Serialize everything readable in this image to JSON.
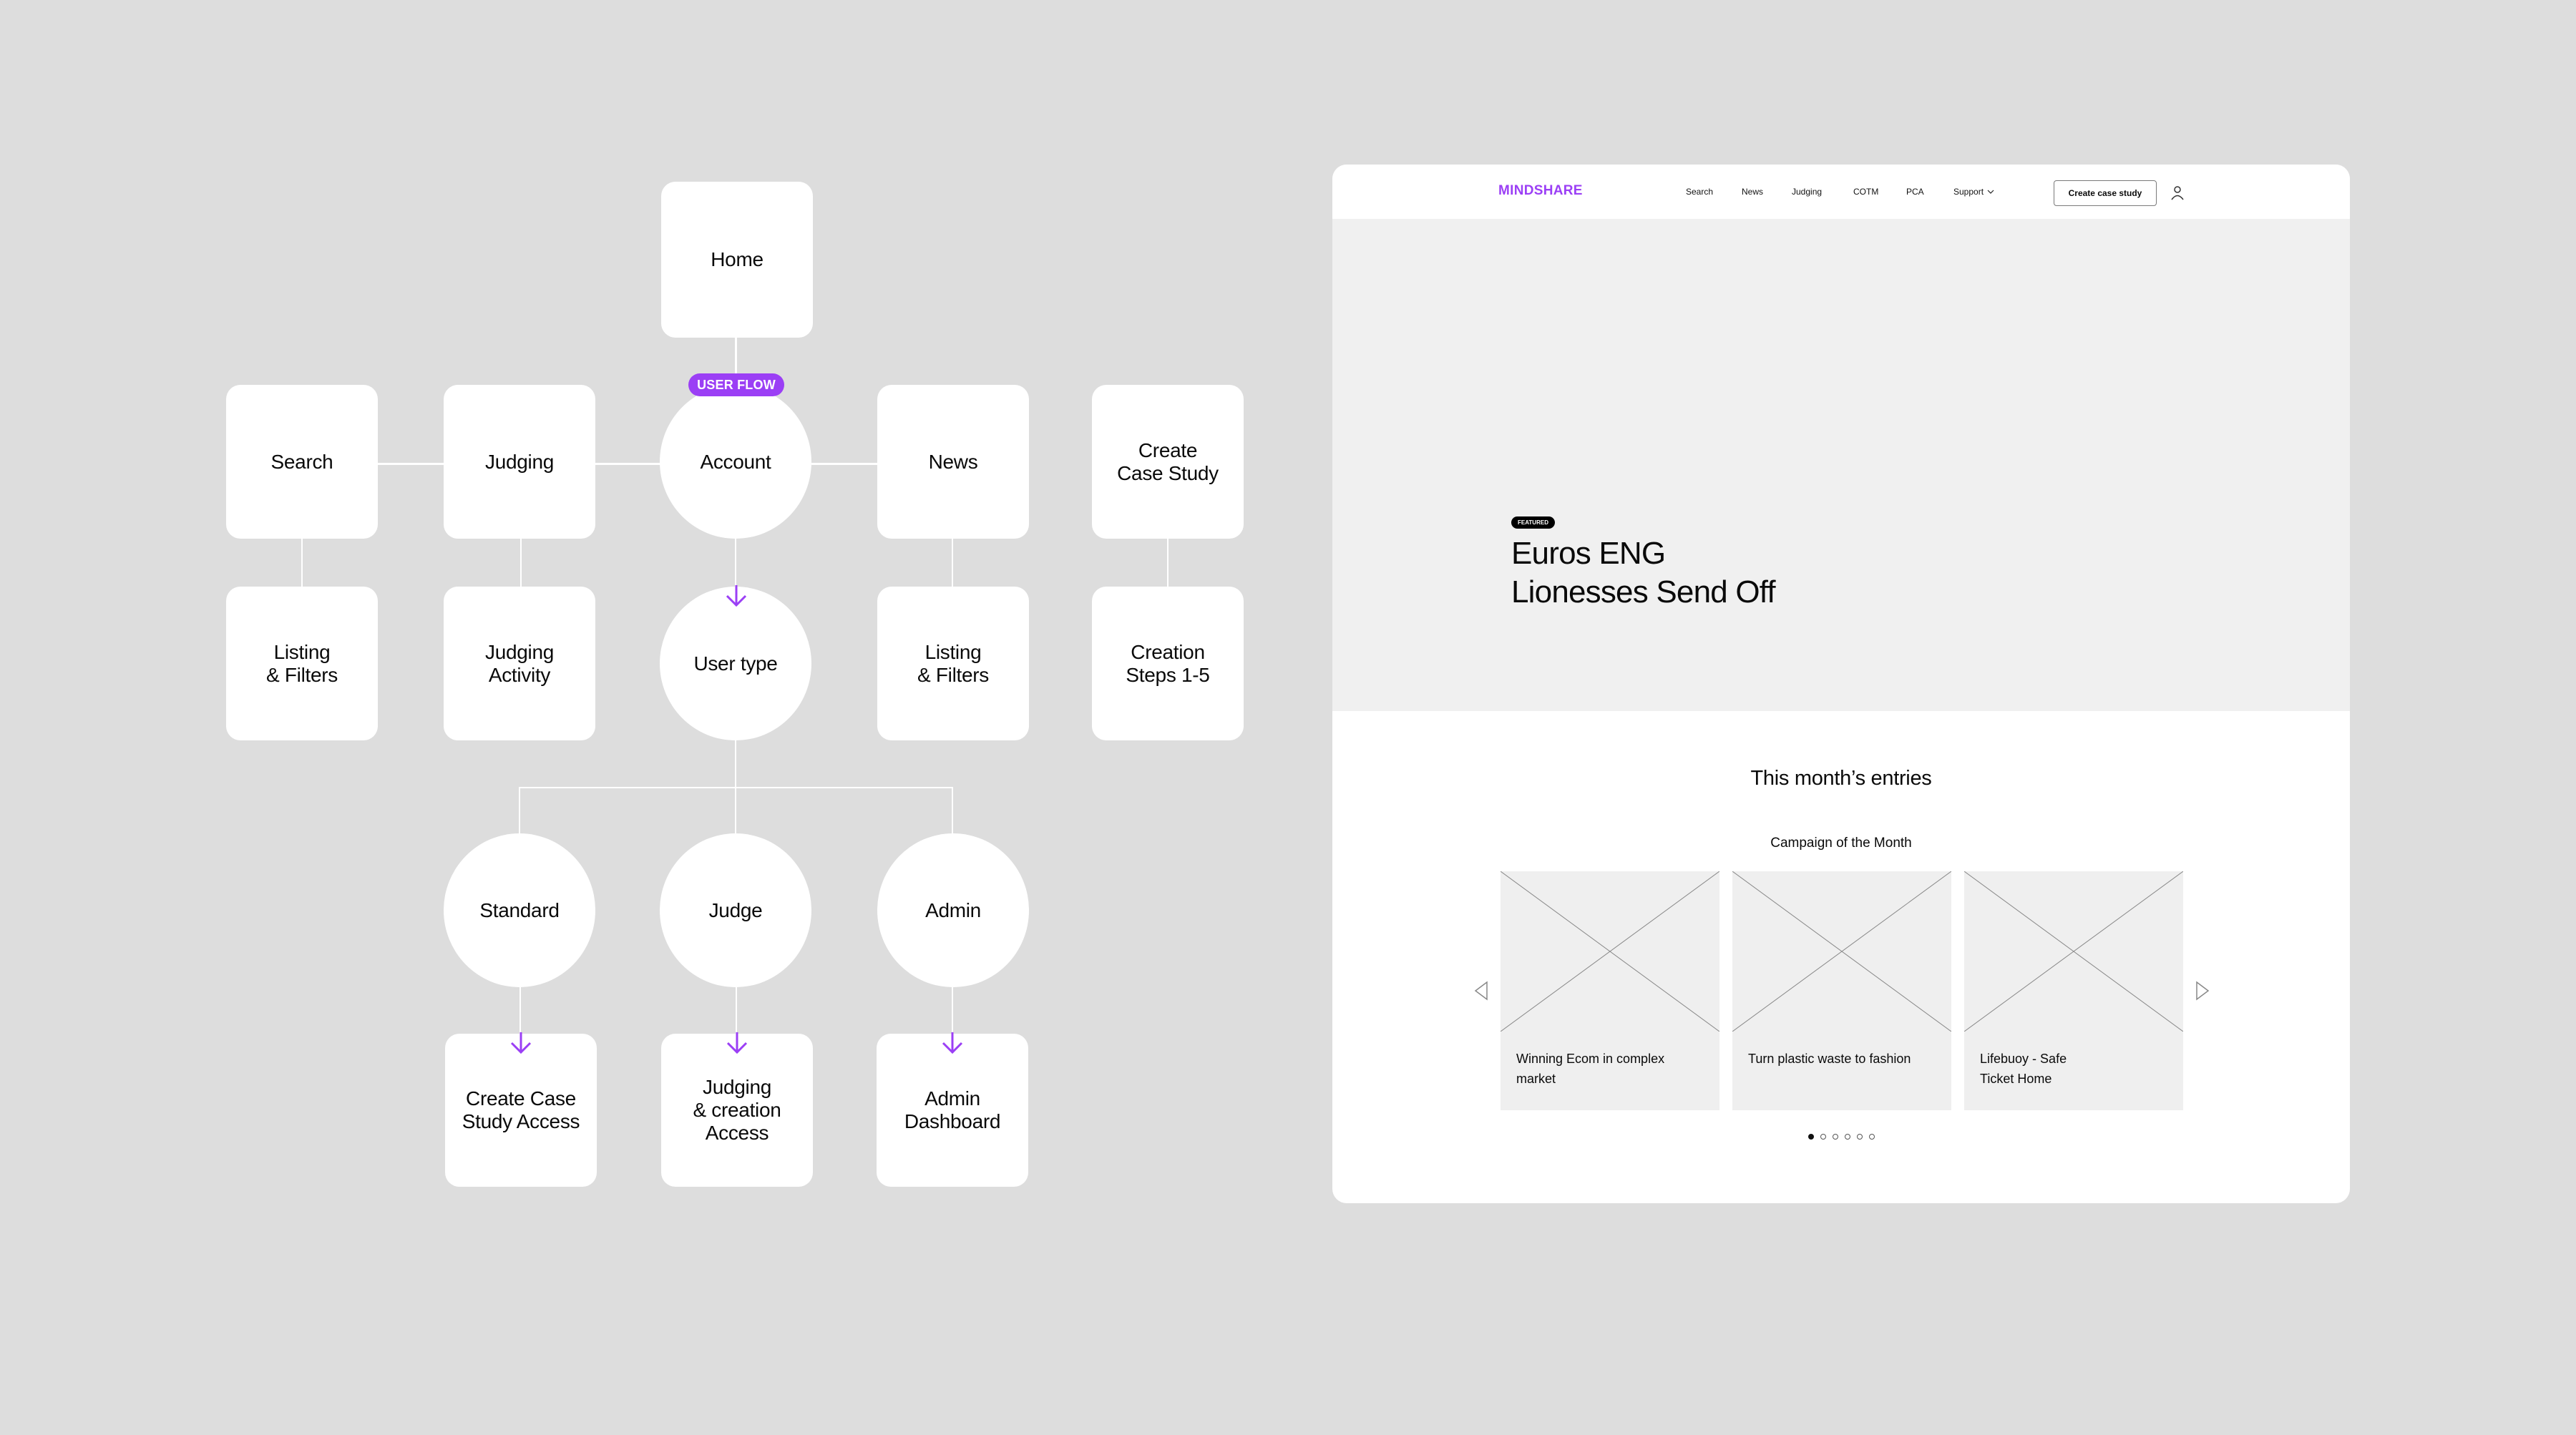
{
  "diagram": {
    "badge": "USER FLOW",
    "nodes": {
      "home": "Home",
      "search": "Search",
      "judging": "Judging",
      "account": "Account",
      "news": "News",
      "create_case_study": "Create\nCase Study",
      "search_listing": "Listing\n& Filters",
      "judging_activity": "Judging\nActivity",
      "user_type": "User type",
      "news_listing": "Listing\n& Filters",
      "creation_steps": "Creation\nSteps 1-5",
      "standard": "Standard",
      "judge": "Judge",
      "admin": "Admin",
      "create_access": "Create Case\nStudy Access",
      "judging_access": "Judging\n& creation\nAccess",
      "admin_dashboard": "Admin\nDashboard"
    },
    "colors": {
      "accent": "#9b3ff5",
      "background": "#dddddd",
      "node": "#ffffff"
    }
  },
  "wireframe": {
    "logo": "MINDSHARE",
    "nav": [
      "Search",
      "News",
      "Judging",
      "COTM",
      "PCA",
      "Support"
    ],
    "cta": "Create case study",
    "hero": {
      "badge": "FEATURED",
      "title": "Euros ENG\nLionesses Send Off"
    },
    "section_title": "This month’s entries",
    "section_subtitle": "Campaign of the Month",
    "cards": [
      "Winning Ecom in complex market",
      "Turn plastic waste to fashion",
      "Lifebuoy - Safe\nTicket Home"
    ],
    "carousel": {
      "pages": 6,
      "active": 1
    }
  }
}
